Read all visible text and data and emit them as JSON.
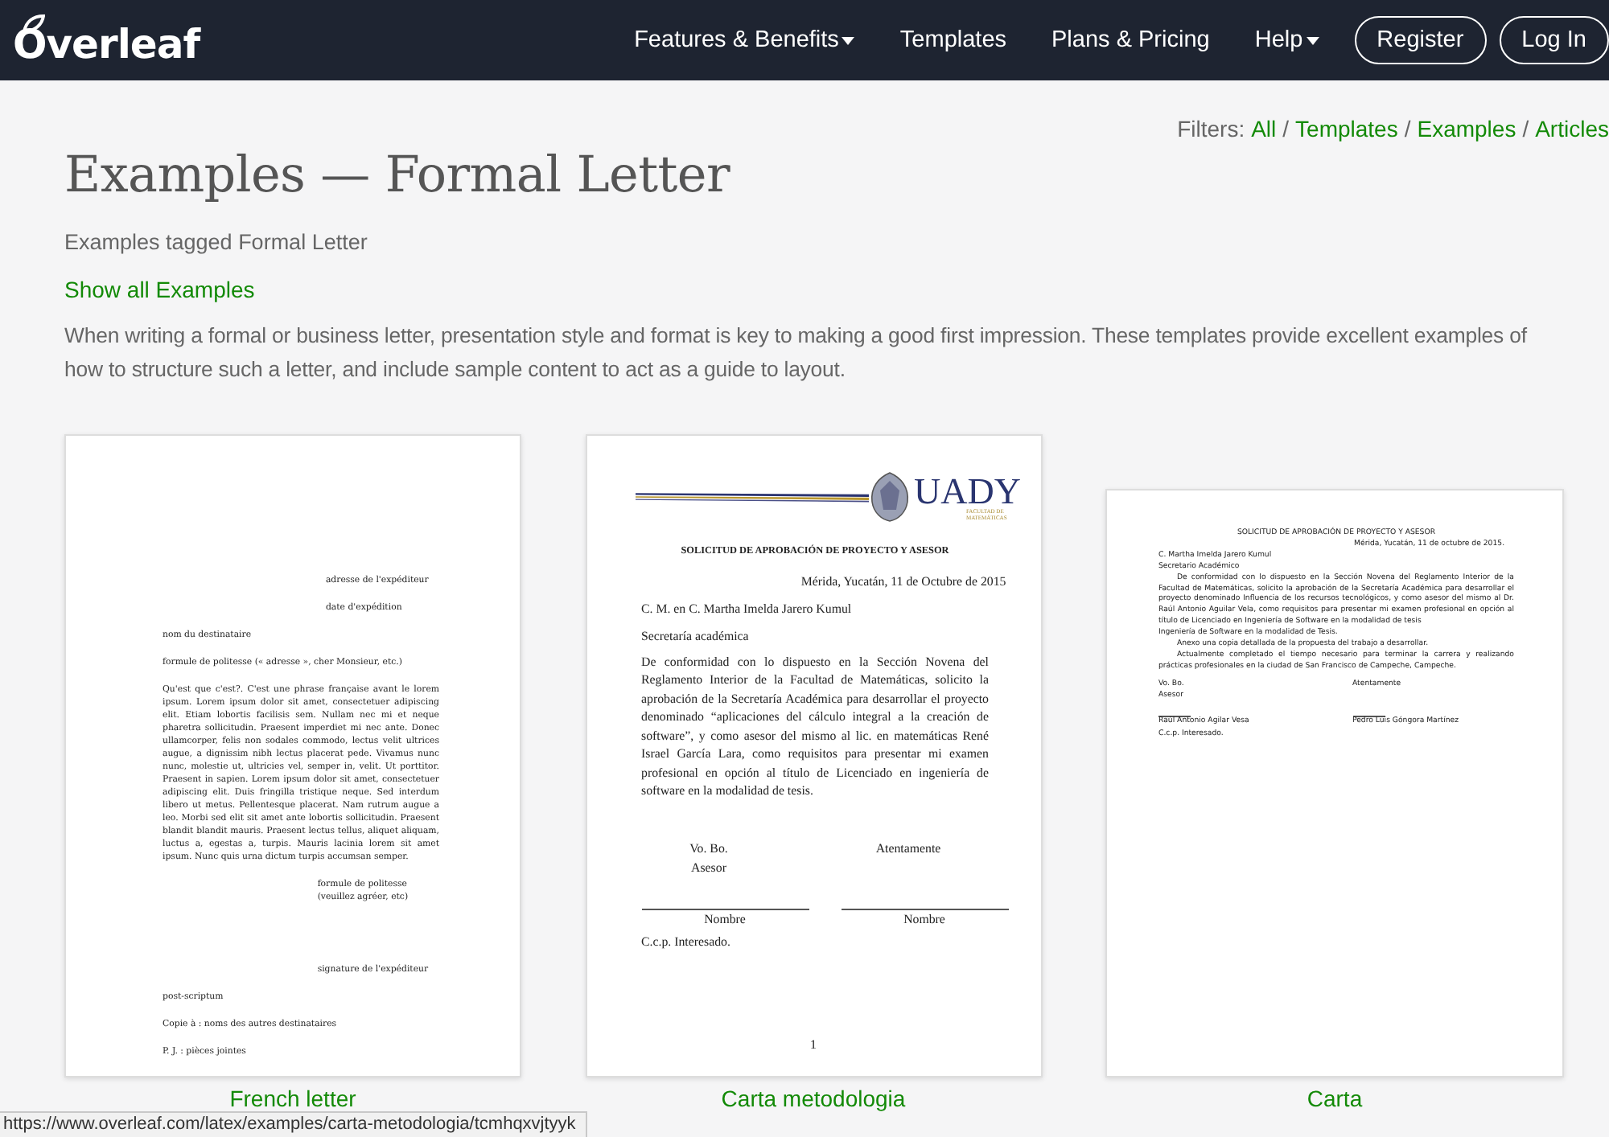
{
  "header": {
    "logo": "Overleaf",
    "nav": [
      {
        "label": "Features & Benefits",
        "dropdown": true
      },
      {
        "label": "Templates",
        "dropdown": false
      },
      {
        "label": "Plans & Pricing",
        "dropdown": false
      },
      {
        "label": "Help",
        "dropdown": true
      }
    ],
    "buttons": [
      "Register",
      "Log In"
    ]
  },
  "filters": {
    "label": "Filters:",
    "separator": "/",
    "links": [
      "All",
      "Templates",
      "Examples",
      "Articles"
    ]
  },
  "title": "Examples — Formal Letter",
  "subtitle": "Examples tagged Formal Letter",
  "show_all": "Show all Examples",
  "description": "When writing a formal or business letter, presentation style and format is key to making a good first impression. These templates provide excellent examples of how to structure such a letter, and include sample content to act as a guide to layout.",
  "examples": [
    {
      "caption": "French letter",
      "document": {
        "blocks": [
          {
            "kind": "right",
            "text": "adresse de l'expéditeur"
          },
          {
            "kind": "right",
            "text": "date d'expédition"
          },
          {
            "kind": "left",
            "text": "nom du destinataire"
          },
          {
            "kind": "left",
            "text": "formule de politesse (« adresse », cher Monsieur, etc.)"
          },
          {
            "kind": "para",
            "text": "Qu'est que c'est?. C'est une phrase française avant le lorem ipsum. Lorem ipsum dolor sit amet, consectetuer adipiscing elit. Etiam lobortis facilisis sem. Nullam nec mi et neque pharetra sollicitudin. Praesent imperdiet mi nec ante. Donec ullamcorper, felis non sodales commodo, lectus velit ultrices augue, a dignissim nibh lectus placerat pede. Vivamus nunc nunc, molestie ut, ultricies vel, semper in, velit. Ut porttitor. Praesent in sapien. Lorem ipsum dolor sit amet, consectetuer adipiscing elit. Duis fringilla tristique neque. Sed interdum libero ut metus. Pellentesque placerat. Nam rutrum augue a leo. Morbi sed elit sit amet ante lobortis sollicitudin. Praesent blandit blandit mauris. Praesent lectus tellus, aliquet aliquam, luctus a, egestas a, turpis. Mauris lacinia lorem sit amet ipsum. Nunc quis urna dictum turpis accumsan semper."
          },
          {
            "kind": "close",
            "text": "formule de politesse (veuillez agréer, etc)"
          },
          {
            "kind": "signature",
            "text": "signature de l'expéditeur"
          },
          {
            "kind": "left",
            "text": "post-scriptum"
          },
          {
            "kind": "left",
            "text": "Copie à : noms des autres destinataires"
          },
          {
            "kind": "left",
            "text": "P. J. : pièces jointes"
          }
        ]
      }
    },
    {
      "caption": "Carta metodologia",
      "document": {
        "blocks": [
          {
            "kind": "letterhead",
            "text": "UADY",
            "subtext": "FACULTAD DE MATEMÁTICAS"
          },
          {
            "kind": "heading",
            "text": "SOLICITUD DE APROBACIÓN DE PROYECTO Y ASESOR"
          },
          {
            "kind": "right",
            "text": "Mérida, Yucatán, 11 de Octubre de 2015"
          },
          {
            "kind": "left",
            "text": "C. M. en C. Martha Imelda Jarero Kumul"
          },
          {
            "kind": "left",
            "text": "Secretaría académica"
          },
          {
            "kind": "para",
            "text": "De conformidad con lo dispuesto en la Sección Novena del Reglamento Interior de la Facultad de Matemáticas, solicito la aprobación de la Secretaría Académica para desarrollar el proyecto denominado “aplicaciones del cálculo integral a la creación de software”, y como asesor del mismo al lic. en matemáticas René Israel García Lara, como requisitos para presentar mi examen profesional en opción al título de Licenciado en ingeniería de software en la modalidad de tesis."
          },
          {
            "kind": "signatures",
            "columns": [
              {
                "lines": [
                  "Vo. Bo.",
                  "Asesor"
                ],
                "name": "Nombre"
              },
              {
                "lines": [
                  "Atentamente"
                ],
                "name": "Nombre"
              }
            ]
          },
          {
            "kind": "left",
            "text": "C.c.p. Interesado."
          },
          {
            "kind": "page-number",
            "text": "1"
          }
        ]
      }
    },
    {
      "caption": "Carta",
      "document": {
        "blocks": [
          {
            "kind": "heading",
            "text": "SOLICITUD DE APROBACIÓN DE PROYECTO Y ASESOR"
          },
          {
            "kind": "right",
            "text": "Mérida, Yucatán, 11 de octubre de 2015."
          },
          {
            "kind": "left",
            "text": "C. Martha Imelda Jarero Kumul"
          },
          {
            "kind": "left",
            "text": "Secretario Académico"
          },
          {
            "kind": "indent",
            "text": "De conformidad con lo dispuesto en la Sección Novena del Reglamento Interior de la Facultad de Matemáticas, solicito la aprobación de la Secretaría Académica para desarrollar el proyecto denominado Influencia de los recursos tecnológicos, y como asesor del mismo al Dr. Raúl Antonio Aguilar Vela, como requisitos para presentar mi examen profesional en opción al título de Licenciado en Ingeniería de Software en la modalidad de tesis"
          },
          {
            "kind": "left",
            "text": "Ingeniería de Software en la modalidad de Tesis."
          },
          {
            "kind": "indent",
            "text": "Anexo una copia detallada de la propuesta del trabajo a desarrollar."
          },
          {
            "kind": "indent",
            "text": "Actualmente completado el tiempo necesario para terminar la carrera y realizando prácticas profesionales en la ciudad de San Francisco de Campeche, Campeche."
          },
          {
            "kind": "signatures",
            "columns": [
              {
                "lines": [
                  "Vo. Bo.",
                  "Asesor"
                ],
                "name": "Raúl Antonio Agilar Vesa"
              },
              {
                "lines": [
                  "Atentamente"
                ],
                "name": "Pedro Luis Góngora Martínez"
              }
            ]
          },
          {
            "kind": "left",
            "text": "C.c.p. Interesado."
          }
        ]
      }
    }
  ],
  "status_url": "https://www.overleaf.com/latex/examples/carta-metodologia/tcmhqxvjtyyk"
}
